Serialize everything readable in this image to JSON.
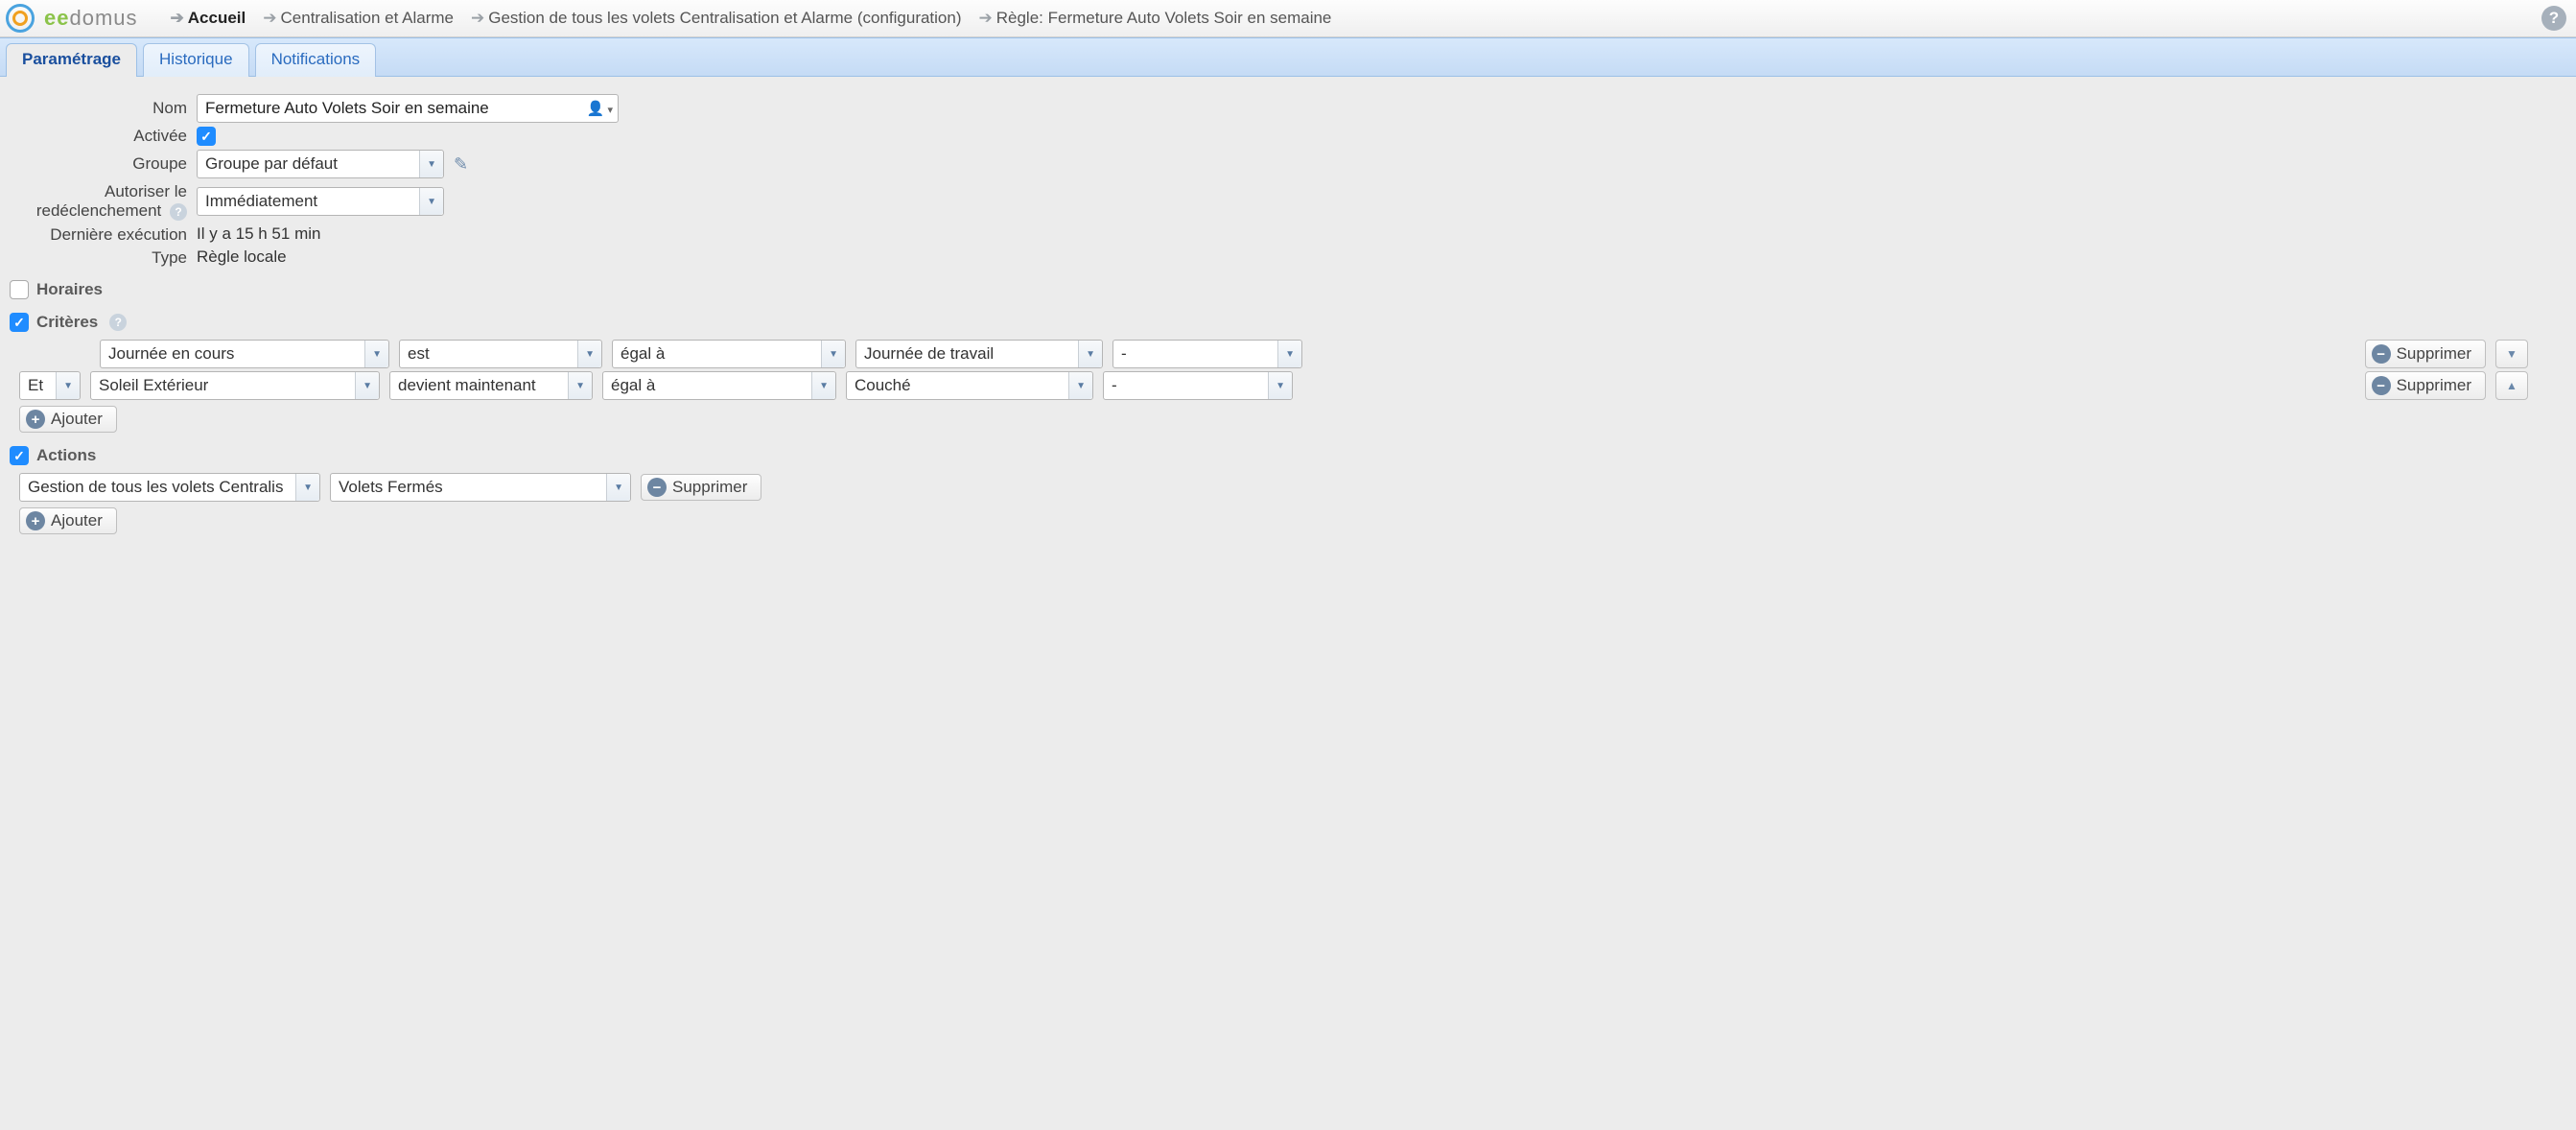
{
  "brand": {
    "ee": "ee",
    "domus": "domus"
  },
  "breadcrumbs": [
    {
      "label": "Accueil",
      "active": true
    },
    {
      "label": "Centralisation et Alarme",
      "active": false
    },
    {
      "label": "Gestion de tous les volets Centralisation et Alarme (configuration)",
      "active": false
    },
    {
      "label": "Règle: Fermeture Auto Volets Soir en semaine",
      "active": false
    }
  ],
  "help_glyph": "?",
  "tabs": [
    {
      "label": "Paramétrage",
      "active": true
    },
    {
      "label": "Historique",
      "active": false
    },
    {
      "label": "Notifications",
      "active": false
    }
  ],
  "form": {
    "nom": {
      "label": "Nom",
      "value": "Fermeture Auto Volets Soir en semaine",
      "user_icon": "👤"
    },
    "activee": {
      "label": "Activée",
      "checked": true
    },
    "groupe": {
      "label": "Groupe",
      "value": "Groupe par défaut"
    },
    "redecl": {
      "label": "Autoriser le redéclenchement",
      "value": "Immédiatement"
    },
    "derniere": {
      "label": "Dernière exécution",
      "value": "Il y a 15 h 51 min"
    },
    "type": {
      "label": "Type",
      "value": "Règle locale"
    }
  },
  "sections": {
    "horaires": {
      "title": "Horaires",
      "checked": false
    },
    "criteres": {
      "title": "Critères",
      "checked": true
    },
    "actions": {
      "title": "Actions",
      "checked": true
    }
  },
  "criteria": [
    {
      "op": "",
      "source": "Journée en cours",
      "verb": "est",
      "comparator": "égal à",
      "value": "Journée de travail",
      "extra": "-"
    },
    {
      "op": "Et",
      "source": "Soleil Extérieur",
      "verb": "devient maintenant",
      "comparator": "égal à",
      "value": "Couché",
      "extra": "-"
    }
  ],
  "actions_list": [
    {
      "device": "Gestion de tous les volets Centralis",
      "value": "Volets Fermés"
    }
  ],
  "buttons": {
    "delete": "Supprimer",
    "add": "Ajouter"
  },
  "icons": {
    "plus": "+",
    "minus": "−",
    "down": "▼",
    "up": "▲",
    "pencil": "✎",
    "q": "?"
  }
}
